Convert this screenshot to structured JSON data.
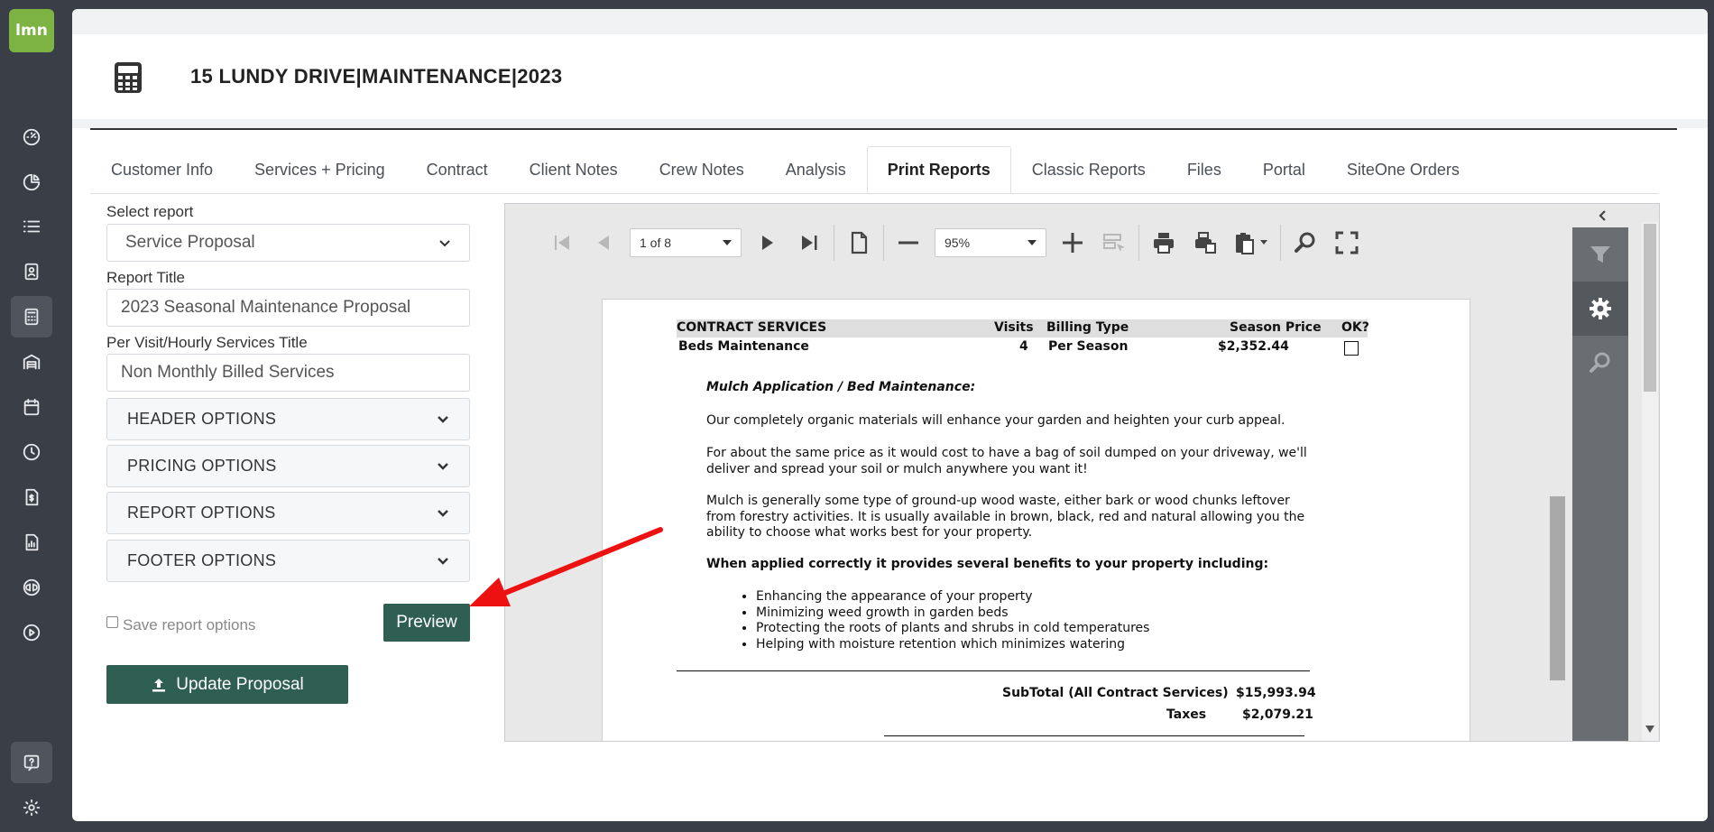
{
  "logo": "lmn",
  "nav": [
    {
      "icon": "dashboard-icon",
      "active": false
    },
    {
      "icon": "pie-chart-icon",
      "active": false
    },
    {
      "icon": "list-icon",
      "active": false
    },
    {
      "icon": "contact-card-icon",
      "active": false
    },
    {
      "icon": "calculator-icon",
      "active": true
    },
    {
      "icon": "warehouse-icon",
      "active": false
    },
    {
      "icon": "calendar-icon",
      "active": false
    },
    {
      "icon": "clock-icon",
      "active": false
    },
    {
      "icon": "invoice-icon",
      "active": false
    },
    {
      "icon": "report-icon",
      "active": false
    },
    {
      "icon": "quickbooks-icon",
      "active": false
    },
    {
      "icon": "play-icon",
      "active": false
    },
    {
      "icon": "help-icon",
      "active": false
    },
    {
      "icon": "settings-icon",
      "active": false
    }
  ],
  "header": {
    "title": "15 LUNDY DRIVE|MAINTENANCE|2023"
  },
  "tabs": [
    {
      "label": "Customer Info"
    },
    {
      "label": "Services + Pricing"
    },
    {
      "label": "Contract"
    },
    {
      "label": "Client Notes"
    },
    {
      "label": "Crew Notes"
    },
    {
      "label": "Analysis"
    },
    {
      "label": "Print Reports"
    },
    {
      "label": "Classic Reports"
    },
    {
      "label": "Files"
    },
    {
      "label": "Portal"
    },
    {
      "label": "SiteOne Orders"
    }
  ],
  "active_tab": "Print Reports",
  "form": {
    "select_report_label": "Select report",
    "select_report_value": "Service Proposal",
    "report_title_label": "Report Title",
    "report_title_value": "2023 Seasonal Maintenance Proposal",
    "per_visit_label": "Per Visit/Hourly Services Title",
    "per_visit_value": "Non Monthly Billed Services",
    "accordions": [
      "HEADER OPTIONS",
      "PRICING OPTIONS",
      "REPORT OPTIONS",
      "FOOTER OPTIONS"
    ],
    "save_options_label": "Save report options",
    "preview_label": "Preview",
    "update_label": "Update Proposal"
  },
  "viewer": {
    "page_indicator": "1 of 8",
    "zoom": "95%"
  },
  "document": {
    "columns": {
      "service": "CONTRACT SERVICES",
      "visits": "Visits",
      "billing": "Billing Type",
      "price": "Season Price",
      "ok": "OK?"
    },
    "row": {
      "service": "Beds Maintenance",
      "visits": "4",
      "billing": "Per Season",
      "price": "$2,352.44"
    },
    "heading": "Mulch Application / Bed Maintenance:",
    "p1": "Our completely organic materials will enhance your garden and heighten your curb appeal.",
    "p2": "For about the same price as it would cost to have a bag of soil dumped on your driveway, we'll deliver and spread your soil or mulch anywhere you want it!",
    "p3": "Mulch is generally some type of ground-up wood waste, either bark or wood chunks leftover from forestry activities.  It is usually available in brown, black, red and natural allowing you the ability to choose what works best for your property.",
    "benefits_heading": "When applied correctly it provides several benefits to your property including:",
    "bullets": [
      "Enhancing the appearance of your property",
      "Minimizing weed growth in garden beds",
      "Protecting the roots of plants and shrubs in cold temperatures",
      "Helping with moisture retention which minimizes watering"
    ],
    "subtotal_label": "SubTotal (All Contract Services)",
    "subtotal_value": "$15,993.94",
    "taxes_label": "Taxes",
    "taxes_value": "$2,079.21"
  },
  "colors": {
    "accent": "#2f5e52",
    "logo": "#7cb342",
    "sidebar": "#3a3e46",
    "annotation_arrow": "#ee1111"
  }
}
